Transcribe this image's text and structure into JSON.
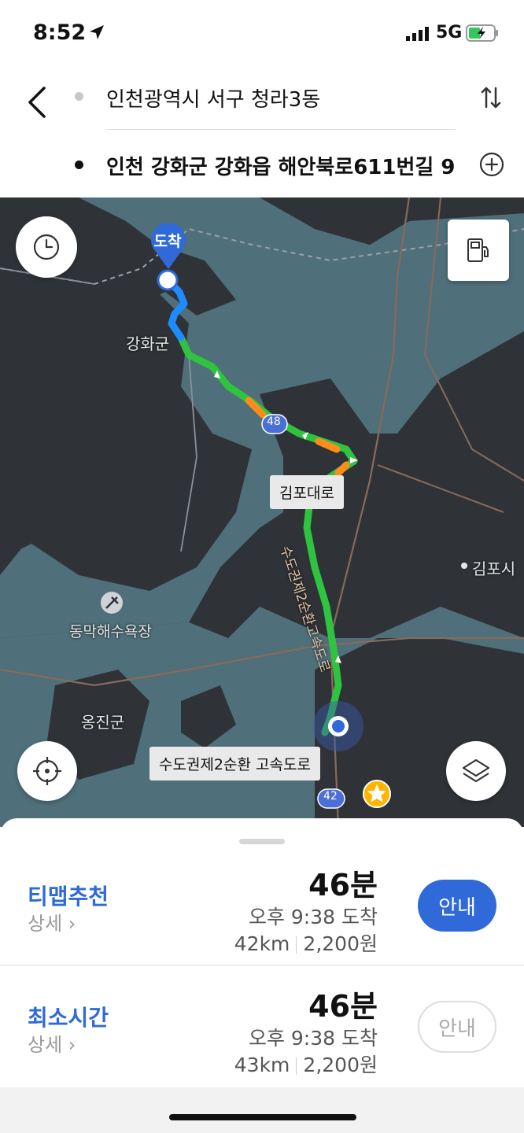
{
  "status_bar": {
    "time": "8:52",
    "network": "5G"
  },
  "header": {
    "origin": "인천광역시 서구 청라3동",
    "destination": "인천 강화군 강화읍 해안북로611번길 9"
  },
  "map": {
    "destination_pin": "도착",
    "place_labels": {
      "ganghwa": "강화군",
      "gimpo": "김포시",
      "beach": "동막해수욕장",
      "ongjin": "옹진군"
    },
    "road_tags": {
      "gimpo_road": "김포대로",
      "expressway": "수도권제2순환 고속도로"
    },
    "route_text": "수도권제2순환고속도로",
    "shields": {
      "r48": "48",
      "r42": "42"
    },
    "icons": [
      "clock-icon",
      "gas-station-icon",
      "locate-icon",
      "layers-icon",
      "star-icon"
    ]
  },
  "routes": [
    {
      "name": "티맵추천",
      "detail": "상세",
      "duration": "46분",
      "arrival": "오후 9:38 도착",
      "distance": "42km",
      "toll": "2,200원",
      "button": "안내",
      "selected": true
    },
    {
      "name": "최소시간",
      "detail": "상세",
      "duration": "46분",
      "arrival": "오후 9:38 도착",
      "distance": "43km",
      "toll": "2,200원",
      "button": "안내",
      "selected": false
    }
  ],
  "colors": {
    "accent_blue": "#2f6ad8",
    "route_green": "#2fc43f",
    "route_blue": "#1e8cff",
    "congestion_orange": "#ff8c1a",
    "map_land": "#2f3338",
    "map_water": "#4f6f7a"
  }
}
